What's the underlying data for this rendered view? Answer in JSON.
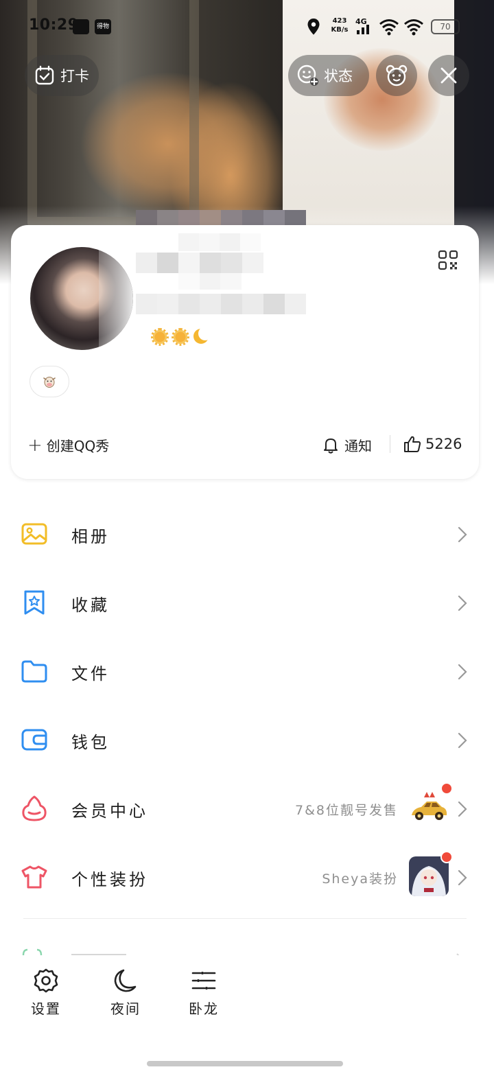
{
  "status_bar": {
    "time": "10:29",
    "app_badge": "得物",
    "network_speed_value": "423",
    "network_speed_unit": "KB/s",
    "network_type": "4G",
    "battery": "70"
  },
  "header": {
    "checkin_label": "打卡",
    "status_label": "状态"
  },
  "profile": {
    "qq_show_label": "创建QQ秀",
    "notify_label": "通知",
    "likes_count": "5226"
  },
  "menu": {
    "items": [
      {
        "label": "相册",
        "hint": "",
        "icon": "album-icon",
        "color": "#f2bd28"
      },
      {
        "label": "收藏",
        "hint": "",
        "icon": "favorites-icon",
        "color": "#2f8ef0"
      },
      {
        "label": "文件",
        "hint": "",
        "icon": "folder-icon",
        "color": "#2f8ef0"
      },
      {
        "label": "钱包",
        "hint": "",
        "icon": "wallet-icon",
        "color": "#2f8ef0"
      },
      {
        "label": "会员中心",
        "hint": "7&8位靓号发售",
        "icon": "vip-icon",
        "color": "#ee5566"
      },
      {
        "label": "个性装扮",
        "hint": "Sheya装扮",
        "icon": "tshirt-icon",
        "color": "#ee5566"
      }
    ]
  },
  "bottom_bar": {
    "settings_label": "设置",
    "night_label": "夜间",
    "woolong_label": "卧龙"
  },
  "colors": {
    "accent_red": "#f04a3a",
    "accent_blue": "#2f8ef0",
    "accent_yellow": "#f2bd28",
    "accent_pink": "#ee5566"
  }
}
